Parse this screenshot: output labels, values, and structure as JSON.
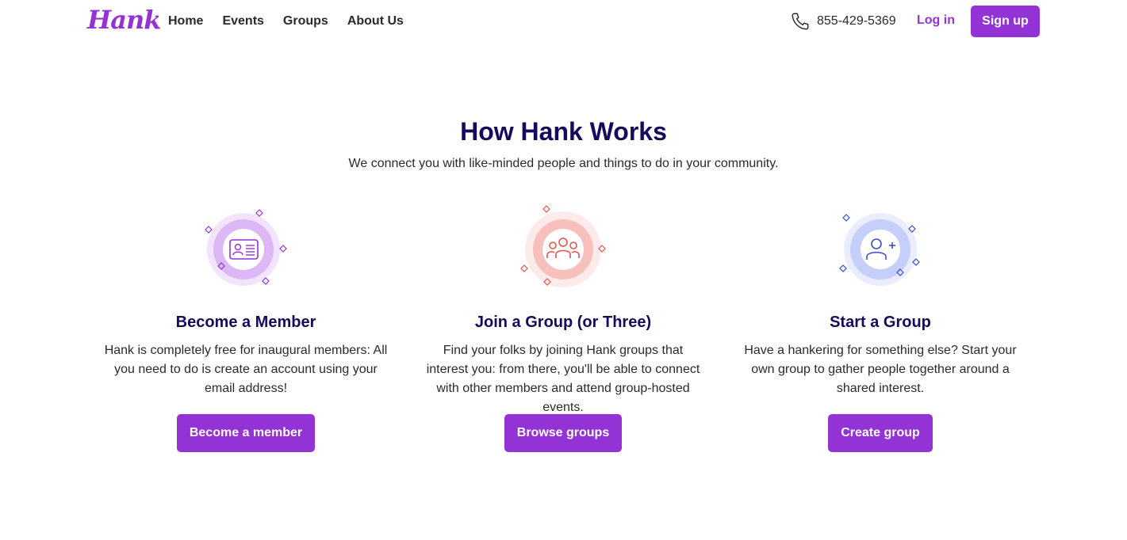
{
  "header": {
    "logo": "Hank",
    "nav": [
      "Home",
      "Events",
      "Groups",
      "About Us"
    ],
    "phone": "855-429-5369",
    "login": "Log in",
    "signup": "Sign up"
  },
  "main": {
    "title": "How Hank Works",
    "subtitle": "We connect you with like-minded people and things to do in your community.",
    "steps": [
      {
        "icon": "id-card-icon",
        "title": "Become a Member",
        "text": "Hank is completely free for inaugural members: All you need to do is create an account using your email address!",
        "button": "Become a member",
        "color": "#c98ff0"
      },
      {
        "icon": "group-people-icon",
        "title": "Join a Group (or Three)",
        "text": "Find your folks by joining Hank groups that interest you: from there, you'll be able to connect with other members and attend group-hosted events.",
        "button": "Browse groups",
        "color": "#f08c8c"
      },
      {
        "icon": "add-user-icon",
        "title": "Start a Group",
        "text": "Have a hankering for something else? Start your own group to gather people together around a shared interest.",
        "button": "Create group",
        "color": "#8fa3f0"
      }
    ]
  },
  "colors": {
    "brand": "#9333d6",
    "heading": "#150a5c"
  }
}
